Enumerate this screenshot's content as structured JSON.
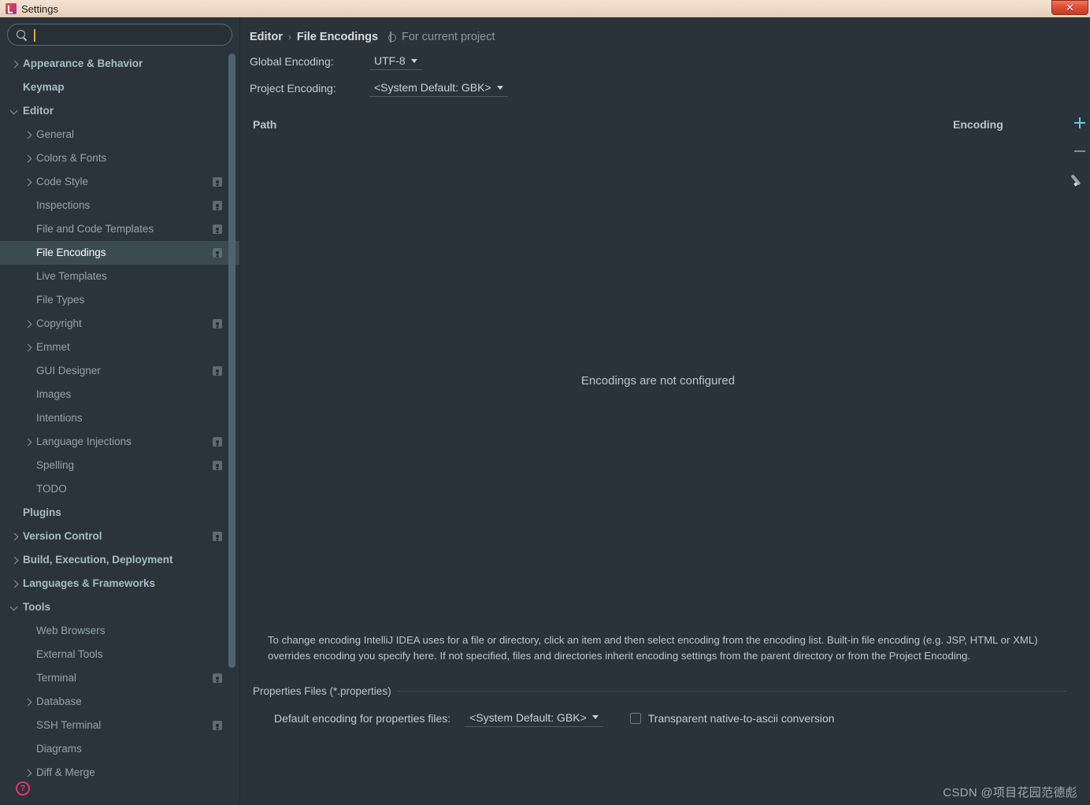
{
  "window": {
    "title": "Settings",
    "app_icon": "intellij-idea-icon",
    "close_label": "✕"
  },
  "search": {
    "placeholder": "",
    "value": "",
    "icon": "search-icon"
  },
  "sidebar": {
    "items": [
      {
        "label": "Appearance & Behavior",
        "level": 0,
        "arrow": "collapsed",
        "badge": false,
        "selected": false
      },
      {
        "label": "Keymap",
        "level": 0,
        "arrow": "none",
        "badge": false,
        "selected": false
      },
      {
        "label": "Editor",
        "level": 0,
        "arrow": "expanded",
        "badge": false,
        "selected": false
      },
      {
        "label": "General",
        "level": 1,
        "arrow": "collapsed",
        "badge": false,
        "selected": false
      },
      {
        "label": "Colors & Fonts",
        "level": 1,
        "arrow": "collapsed",
        "badge": false,
        "selected": false
      },
      {
        "label": "Code Style",
        "level": 1,
        "arrow": "collapsed",
        "badge": true,
        "selected": false
      },
      {
        "label": "Inspections",
        "level": 1,
        "arrow": "none",
        "badge": true,
        "selected": false
      },
      {
        "label": "File and Code Templates",
        "level": 1,
        "arrow": "none",
        "badge": true,
        "selected": false
      },
      {
        "label": "File Encodings",
        "level": 1,
        "arrow": "none",
        "badge": true,
        "selected": true
      },
      {
        "label": "Live Templates",
        "level": 1,
        "arrow": "none",
        "badge": false,
        "selected": false
      },
      {
        "label": "File Types",
        "level": 1,
        "arrow": "none",
        "badge": false,
        "selected": false
      },
      {
        "label": "Copyright",
        "level": 1,
        "arrow": "collapsed",
        "badge": true,
        "selected": false
      },
      {
        "label": "Emmet",
        "level": 1,
        "arrow": "collapsed",
        "badge": false,
        "selected": false
      },
      {
        "label": "GUI Designer",
        "level": 1,
        "arrow": "none",
        "badge": true,
        "selected": false
      },
      {
        "label": "Images",
        "level": 1,
        "arrow": "none",
        "badge": false,
        "selected": false
      },
      {
        "label": "Intentions",
        "level": 1,
        "arrow": "none",
        "badge": false,
        "selected": false
      },
      {
        "label": "Language Injections",
        "level": 1,
        "arrow": "collapsed",
        "badge": true,
        "selected": false
      },
      {
        "label": "Spelling",
        "level": 1,
        "arrow": "none",
        "badge": true,
        "selected": false
      },
      {
        "label": "TODO",
        "level": 1,
        "arrow": "none",
        "badge": false,
        "selected": false
      },
      {
        "label": "Plugins",
        "level": 0,
        "arrow": "none",
        "badge": false,
        "selected": false
      },
      {
        "label": "Version Control",
        "level": 0,
        "arrow": "collapsed",
        "badge": true,
        "selected": false
      },
      {
        "label": "Build, Execution, Deployment",
        "level": 0,
        "arrow": "collapsed",
        "badge": false,
        "selected": false
      },
      {
        "label": "Languages & Frameworks",
        "level": 0,
        "arrow": "collapsed",
        "badge": false,
        "selected": false
      },
      {
        "label": "Tools",
        "level": 0,
        "arrow": "expanded",
        "badge": false,
        "selected": false
      },
      {
        "label": "Web Browsers",
        "level": 1,
        "arrow": "none",
        "badge": false,
        "selected": false
      },
      {
        "label": "External Tools",
        "level": 1,
        "arrow": "none",
        "badge": false,
        "selected": false
      },
      {
        "label": "Terminal",
        "level": 1,
        "arrow": "none",
        "badge": true,
        "selected": false
      },
      {
        "label": "Database",
        "level": 1,
        "arrow": "collapsed",
        "badge": false,
        "selected": false
      },
      {
        "label": "SSH Terminal",
        "level": 1,
        "arrow": "none",
        "badge": true,
        "selected": false
      },
      {
        "label": "Diagrams",
        "level": 1,
        "arrow": "none",
        "badge": false,
        "selected": false
      },
      {
        "label": "Diff & Merge",
        "level": 1,
        "arrow": "collapsed",
        "badge": false,
        "selected": false
      }
    ],
    "help_icon_label": "?"
  },
  "breadcrumb": {
    "parent": "Editor",
    "separator": "›",
    "current": "File Encodings",
    "scope_icon": "gear-icon",
    "scope_note": "For current project"
  },
  "encodings": {
    "global_label": "Global Encoding:",
    "global_value": "UTF-8",
    "project_label": "Project Encoding:",
    "project_value": "<System Default: GBK>"
  },
  "table": {
    "columns": [
      "Path",
      "Encoding"
    ],
    "rows": [],
    "empty_message": "Encodings are not configured",
    "toolbar": {
      "add": "+",
      "remove": "−",
      "edit": "pencil"
    }
  },
  "description": "To change encoding IntelliJ IDEA uses for a file or directory, click an item and then select encoding from the encoding list. Built-in file encoding (e.g. JSP, HTML or XML) overrides encoding you specify here. If not specified, files and directories inherit encoding settings from the parent directory or from the Project Encoding.",
  "properties_group": {
    "title": "Properties Files (*.properties)",
    "default_encoding_label": "Default encoding for properties files:",
    "default_encoding_value": "<System Default: GBK>",
    "checkbox_label": "Transparent native-to-ascii conversion",
    "checkbox_checked": false
  },
  "watermark": "CSDN @项目花园范德彪",
  "colors": {
    "background": "#2a333a",
    "sidebar": "#2b343b",
    "selected_row": "#3c4b52",
    "accent_add": "#5fc9e8",
    "titlebar": "#ecd9c6",
    "close_button": "#e2533a",
    "search_border": "#4d7078",
    "caret": "#e8a33d"
  }
}
